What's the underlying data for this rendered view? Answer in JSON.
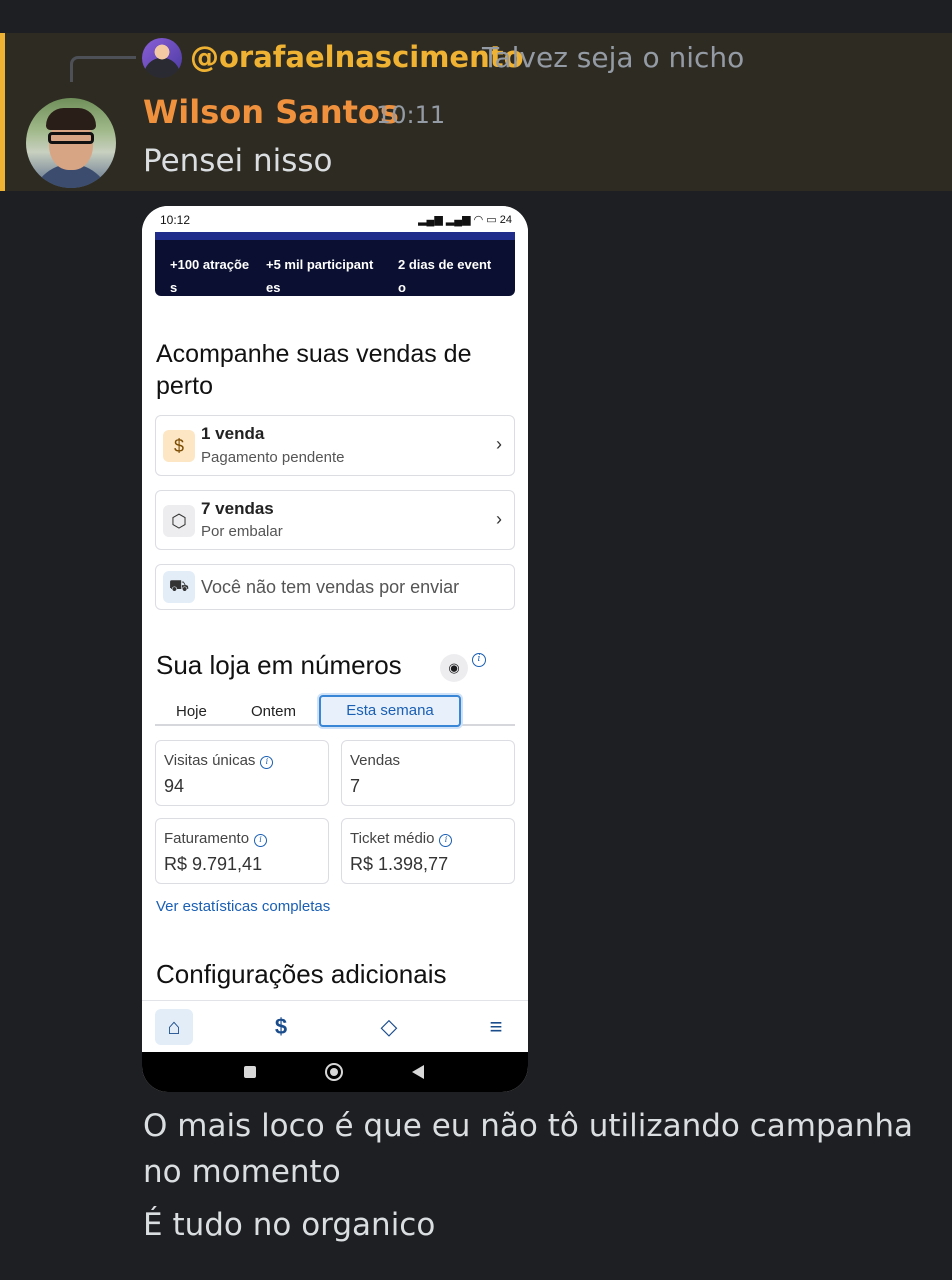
{
  "reply": {
    "mention": "@orafaelnascimento",
    "text": "Talvez seja o nicho"
  },
  "message": {
    "author": "Wilson Santos",
    "timestamp": "10:11",
    "text_1": "Pensei nisso",
    "text_2": "O mais loco é que eu não tô utilizando campanha no momento",
    "text_3": "É tudo no organico"
  },
  "colors": {
    "mention": "#f0b232",
    "author": "#f0913d",
    "highlight_bg": "#2e2b22",
    "link": "#1a5fb4"
  },
  "phone": {
    "status": {
      "time": "10:12",
      "battery": "24"
    },
    "banner": [
      {
        "line1": "+100 atraçõe",
        "line2": "s"
      },
      {
        "line1": "+5 mil participant",
        "line2": "es"
      },
      {
        "line1": "2 dias de event",
        "line2": "o"
      }
    ],
    "sales_heading": "Acompanhe suas vendas de perto",
    "sales_cards": [
      {
        "title": "1 venda",
        "subtitle": "Pagamento pendente",
        "icon": "dollar-icon"
      },
      {
        "title": "7 vendas",
        "subtitle": "Por embalar",
        "icon": "box-icon"
      }
    ],
    "no_shipping": "Você não tem vendas por enviar",
    "store_heading": "Sua loja em números",
    "tabs": [
      "Hoje",
      "Ontem",
      "Esta semana"
    ],
    "active_tab": "Esta semana",
    "stats": [
      {
        "label": "Visitas únicas",
        "value": "94"
      },
      {
        "label": "Vendas",
        "value": "7"
      },
      {
        "label": "Faturamento",
        "value": "R$ 9.791,41"
      },
      {
        "label": "Ticket médio",
        "value": "R$ 1.398,77"
      }
    ],
    "stats_link": "Ver estatísticas completas",
    "config_heading": "Configurações adicionais",
    "bottom_nav": [
      "home-icon",
      "dollar-icon",
      "tag-icon",
      "menu-icon"
    ]
  }
}
